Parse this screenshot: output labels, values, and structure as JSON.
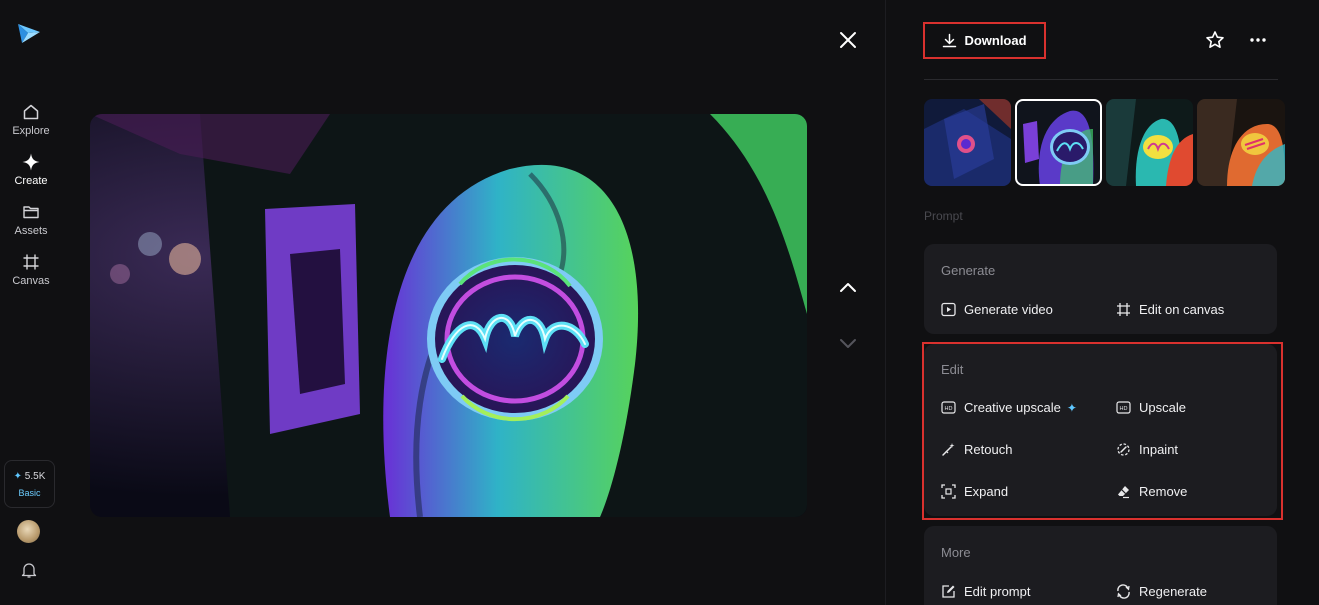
{
  "sidebar": {
    "items": [
      {
        "label": "Explore",
        "icon": "home-icon",
        "active": false
      },
      {
        "label": "Create",
        "icon": "sparkle-icon",
        "active": true
      },
      {
        "label": "Assets",
        "icon": "folder-icon",
        "active": false
      },
      {
        "label": "Canvas",
        "icon": "canvas-frame-icon",
        "active": false
      }
    ],
    "credits": {
      "amount": "5.5K",
      "plan": "Basic"
    }
  },
  "header": {
    "download_label": "Download"
  },
  "thumbnails": [
    {
      "icon": "thumbnail-image",
      "selected": false
    },
    {
      "icon": "thumbnail-image",
      "selected": true
    },
    {
      "icon": "thumbnail-image",
      "selected": false
    },
    {
      "icon": "thumbnail-image",
      "selected": false
    }
  ],
  "prompt": {
    "label": "Prompt"
  },
  "generate": {
    "title": "Generate",
    "options": [
      {
        "label": "Generate video",
        "icon": "play-square-icon"
      },
      {
        "label": "Edit on canvas",
        "icon": "canvas-frame-icon"
      }
    ]
  },
  "edit": {
    "title": "Edit",
    "options": [
      {
        "label": "Creative upscale",
        "icon": "hd-icon"
      },
      {
        "label": "Upscale",
        "icon": "hd-icon"
      },
      {
        "label": "Retouch",
        "icon": "magic-wand-icon"
      },
      {
        "label": "Inpaint",
        "icon": "inpaint-icon"
      },
      {
        "label": "Expand",
        "icon": "expand-icon"
      },
      {
        "label": "Remove",
        "icon": "eraser-icon"
      }
    ]
  },
  "more": {
    "title": "More",
    "options": [
      {
        "label": "Edit prompt",
        "icon": "edit-prompt-icon"
      },
      {
        "label": "Regenerate",
        "icon": "regenerate-icon"
      }
    ]
  },
  "colors": {
    "background": "#101012",
    "card": "#1c1c20",
    "highlight": "#d9312e",
    "accent": "#5fc7ff"
  }
}
